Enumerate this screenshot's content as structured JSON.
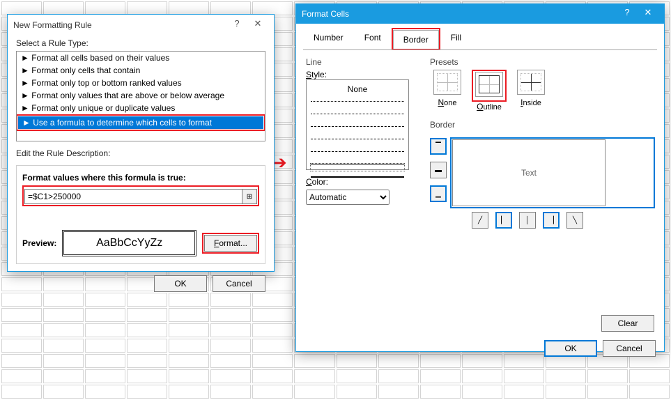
{
  "dlg1": {
    "title": "New Formatting Rule",
    "help": "?",
    "select_label": "Select a Rule Type:",
    "rules": [
      "► Format all cells based on their values",
      "► Format only cells that contain",
      "► Format only top or bottom ranked values",
      "► Format only values that are above or below average",
      "► Format only unique or duplicate values",
      "► Use a formula to determine which cells to format"
    ],
    "edit_label": "Edit the Rule Description:",
    "formula_label": "Format values where this formula is true:",
    "formula_value": "=$C1>250000",
    "preview_label": "Preview:",
    "preview_text": "AaBbCcYyZz",
    "format_btn": "Format...",
    "ok": "OK",
    "cancel": "Cancel"
  },
  "dlg2": {
    "title": "Format Cells",
    "help": "?",
    "tabs": {
      "number": "Number",
      "font": "Font",
      "border": "Border",
      "fill": "Fill"
    },
    "line_label": "Line",
    "style_label": "Style:",
    "none": "None",
    "color_label": "Color:",
    "color_value": "Automatic",
    "presets_label": "Presets",
    "preset_none": "None",
    "preset_outline": "Outline",
    "preset_inside": "Inside",
    "border_label": "Border",
    "preview_text": "Text",
    "clear": "Clear",
    "ok": "OK",
    "cancel": "Cancel"
  }
}
